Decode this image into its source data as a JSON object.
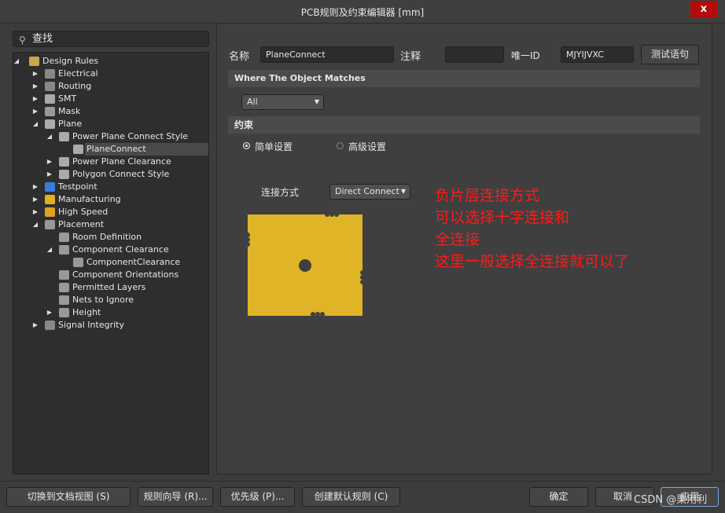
{
  "window": {
    "title": "PCB规则及约束编辑器 [mm]",
    "close": "x"
  },
  "search": {
    "placeholder": "查找"
  },
  "tree": [
    {
      "label": "Design Rules",
      "level": 0,
      "arrow": "open",
      "icon": "design-rules-icon",
      "color": "#c9a84a"
    },
    {
      "label": "Electrical",
      "level": 1,
      "arrow": "closed",
      "icon": "electrical-icon",
      "color": "#888888"
    },
    {
      "label": "Routing",
      "level": 1,
      "arrow": "closed",
      "icon": "routing-icon",
      "color": "#888888"
    },
    {
      "label": "SMT",
      "level": 1,
      "arrow": "closed",
      "icon": "smt-icon",
      "color": "#aaaaaa"
    },
    {
      "label": "Mask",
      "level": 1,
      "arrow": "closed",
      "icon": "mask-icon",
      "color": "#999999"
    },
    {
      "label": "Plane",
      "level": 1,
      "arrow": "open",
      "icon": "plane-icon",
      "color": "#aaaaaa"
    },
    {
      "label": "Power Plane Connect Style",
      "level": 2,
      "arrow": "open",
      "icon": "plane-icon",
      "color": "#aaaaaa"
    },
    {
      "label": "PlaneConnect",
      "level": 3,
      "arrow": "",
      "icon": "plane-icon",
      "color": "#aaaaaa",
      "selected": true
    },
    {
      "label": "Power Plane Clearance",
      "level": 2,
      "arrow": "closed",
      "icon": "plane-icon",
      "color": "#aaaaaa"
    },
    {
      "label": "Polygon Connect Style",
      "level": 2,
      "arrow": "closed",
      "icon": "plane-icon",
      "color": "#aaaaaa"
    },
    {
      "label": "Testpoint",
      "level": 1,
      "arrow": "closed",
      "icon": "testpoint-icon",
      "color": "#3a7be0"
    },
    {
      "label": "Manufacturing",
      "level": 1,
      "arrow": "closed",
      "icon": "manufacturing-icon",
      "color": "#e0b020"
    },
    {
      "label": "High Speed",
      "level": 1,
      "arrow": "closed",
      "icon": "high-speed-icon",
      "color": "#e0a020"
    },
    {
      "label": "Placement",
      "level": 1,
      "arrow": "open",
      "icon": "placement-icon",
      "color": "#999999"
    },
    {
      "label": "Room Definition",
      "level": 2,
      "arrow": "",
      "icon": "placement-icon",
      "color": "#999999"
    },
    {
      "label": "Component Clearance",
      "level": 2,
      "arrow": "open",
      "icon": "placement-icon",
      "color": "#999999"
    },
    {
      "label": "ComponentClearance",
      "level": 3,
      "arrow": "",
      "icon": "placement-icon",
      "color": "#999999"
    },
    {
      "label": "Component Orientations",
      "level": 2,
      "arrow": "",
      "icon": "placement-icon",
      "color": "#999999"
    },
    {
      "label": "Permitted Layers",
      "level": 2,
      "arrow": "",
      "icon": "placement-icon",
      "color": "#999999"
    },
    {
      "label": "Nets to Ignore",
      "level": 2,
      "arrow": "",
      "icon": "placement-icon",
      "color": "#999999"
    },
    {
      "label": "Height",
      "level": 2,
      "arrow": "closed",
      "icon": "placement-icon",
      "color": "#999999"
    },
    {
      "label": "Signal Integrity",
      "level": 1,
      "arrow": "closed",
      "icon": "signal-integrity-icon",
      "color": "#888888"
    }
  ],
  "rule": {
    "name_label": "名称",
    "name_value": "PlaneConnect",
    "comment_label": "注释",
    "comment_value": "",
    "id_label": "唯一ID",
    "id_value": "MJYIJVXC",
    "test_button": "测试语句"
  },
  "where": {
    "header": "Where The Object Matches",
    "scope": "All"
  },
  "constraints": {
    "header": "约束",
    "simple": "简单设置",
    "advanced": "高级设置",
    "simple_selected": true,
    "connect_label": "连接方式",
    "connect_value": "Direct Connect",
    "pad_color": "#dfb426"
  },
  "annotation": [
    "负片层连接方式",
    "可以选择十字连接和",
    "全连接",
    "这里一般选择全连接就可以了"
  ],
  "footer": {
    "doc_view": "切换到文档视图 (S)",
    "wizard": "规则向导 (R)...",
    "priority": "优先级 (P)...",
    "create_default": "创建默认规则 (C)",
    "ok": "确定",
    "cancel": "取消",
    "apply": "应用"
  },
  "watermark": "CSDN @栗用利"
}
